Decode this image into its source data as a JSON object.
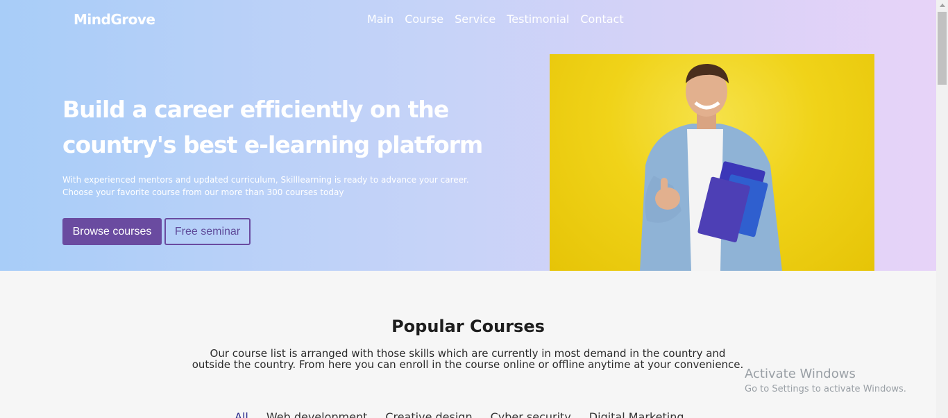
{
  "header": {
    "brand": "MindGrove",
    "nav": [
      "Main",
      "Course",
      "Service",
      "Testimonial",
      "Contact"
    ]
  },
  "hero": {
    "headline": "Build a career efficiently on the country's best e-learning platform",
    "subtext_line1": "With experienced mentors and updated curriculum, Skilllearning is ready to advance your career.",
    "subtext_line2": "Choose your favorite course from our more than 300 courses today",
    "primary_button": "Browse courses",
    "secondary_button": "Free seminar"
  },
  "courses": {
    "title": "Popular Courses",
    "description": "Our course list is arranged with those skills which are currently in most demand in the country and outside the country. From here you can enroll in the course online or offline anytime at your convenience.",
    "filters": [
      "All",
      "Web development",
      "Creative design",
      "Cyber security",
      "Digital Marketing"
    ]
  },
  "watermark": {
    "title": "Activate Windows",
    "subtitle": "Go to Settings to activate Windows."
  },
  "colors": {
    "primary": "#6a4ba0",
    "hero_image_bg": "#f0d319"
  }
}
